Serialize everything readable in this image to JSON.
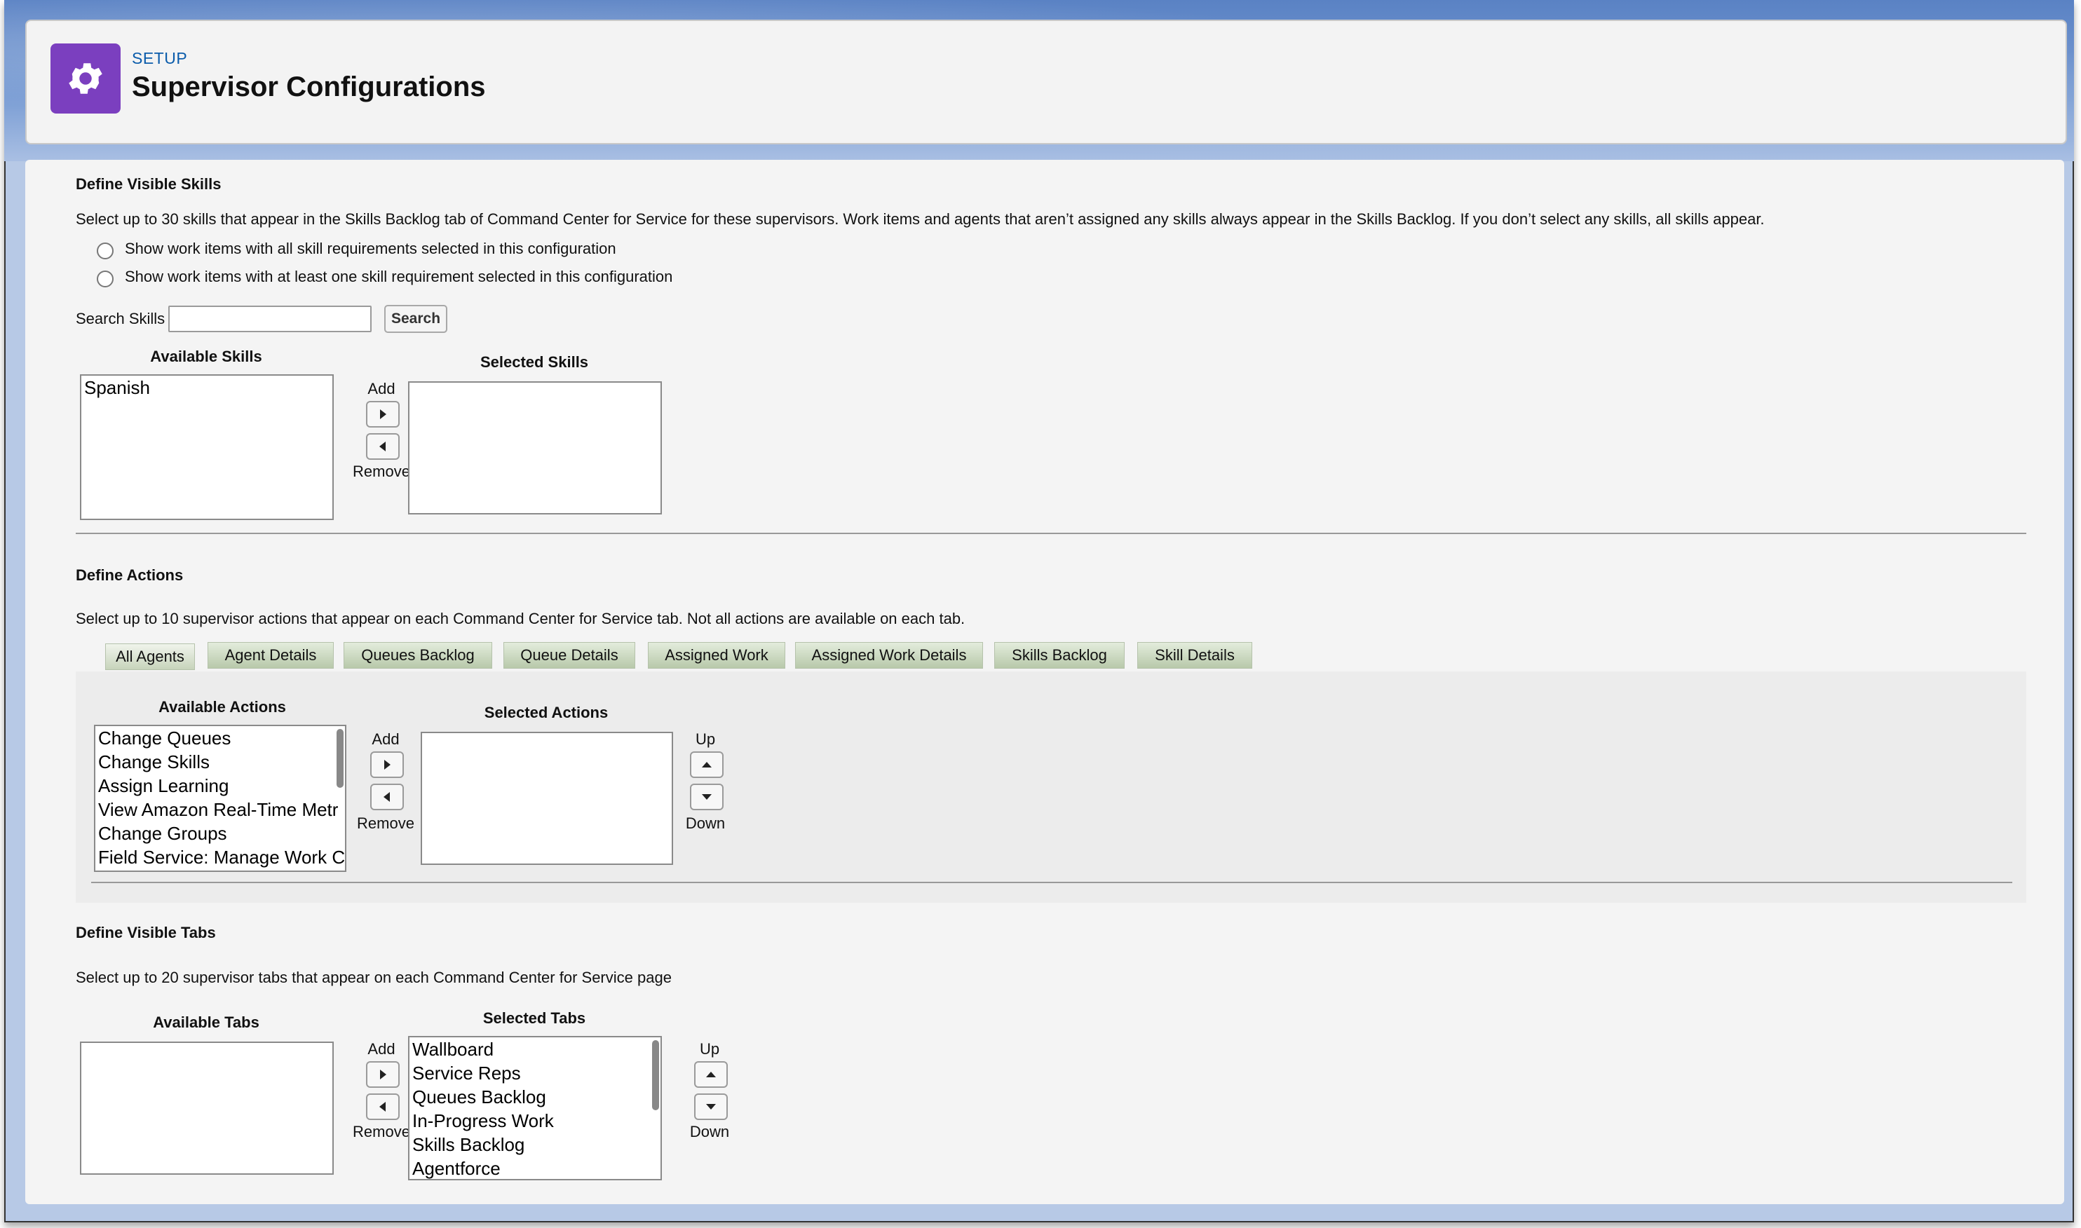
{
  "header": {
    "eyebrow": "SETUP",
    "title": "Supervisor Configurations",
    "icon": "gear-icon",
    "icon_bg": "#7b3fbf"
  },
  "skills_section": {
    "title": "Define Visible Skills",
    "description": "Select up to 30 skills that appear in the Skills Backlog tab of Command Center for Service for these supervisors. Work items and agents that aren’t assigned any skills always appear in the Skills Backlog. If you don’t select any skills, all skills appear.",
    "radio_all": "Show work items with all skill requirements selected in this configuration",
    "radio_one": "Show work items with at least one skill requirement selected in this configuration",
    "search_label": "Search Skills",
    "search_value": "",
    "search_button": "Search",
    "available_heading": "Available Skills",
    "selected_heading": "Selected Skills",
    "available": [
      "Spanish"
    ],
    "selected": [],
    "add_label": "Add",
    "remove_label": "Remove"
  },
  "actions_section": {
    "title": "Define Actions",
    "description": "Select up to 10 supervisor actions that appear on each Command Center for Service tab. Not all actions are available on each tab.",
    "tabs": [
      "All Agents",
      "Agent Details",
      "Queues Backlog",
      "Queue Details",
      "Assigned Work",
      "Assigned Work Details",
      "Skills Backlog",
      "Skill Details"
    ],
    "active_tab": "All Agents",
    "available_heading": "Available Actions",
    "selected_heading": "Selected Actions",
    "available": [
      "Change Queues",
      "Change Skills",
      "Assign Learning",
      "View Amazon Real-Time Metr",
      "Change Groups",
      "Field Service: Manage Work C"
    ],
    "selected": [],
    "add_label": "Add",
    "remove_label": "Remove",
    "up_label": "Up",
    "down_label": "Down"
  },
  "tabs_section": {
    "title": "Define Visible Tabs",
    "description": "Select up to 20 supervisor tabs that appear on each Command Center for Service page",
    "available_heading": "Available Tabs",
    "selected_heading": "Selected Tabs",
    "available": [],
    "selected": [
      "Wallboard",
      "Service Reps",
      "Queues Backlog",
      "In-Progress Work",
      "Skills Backlog",
      "Agentforce"
    ],
    "add_label": "Add",
    "remove_label": "Remove",
    "up_label": "Up",
    "down_label": "Down"
  }
}
